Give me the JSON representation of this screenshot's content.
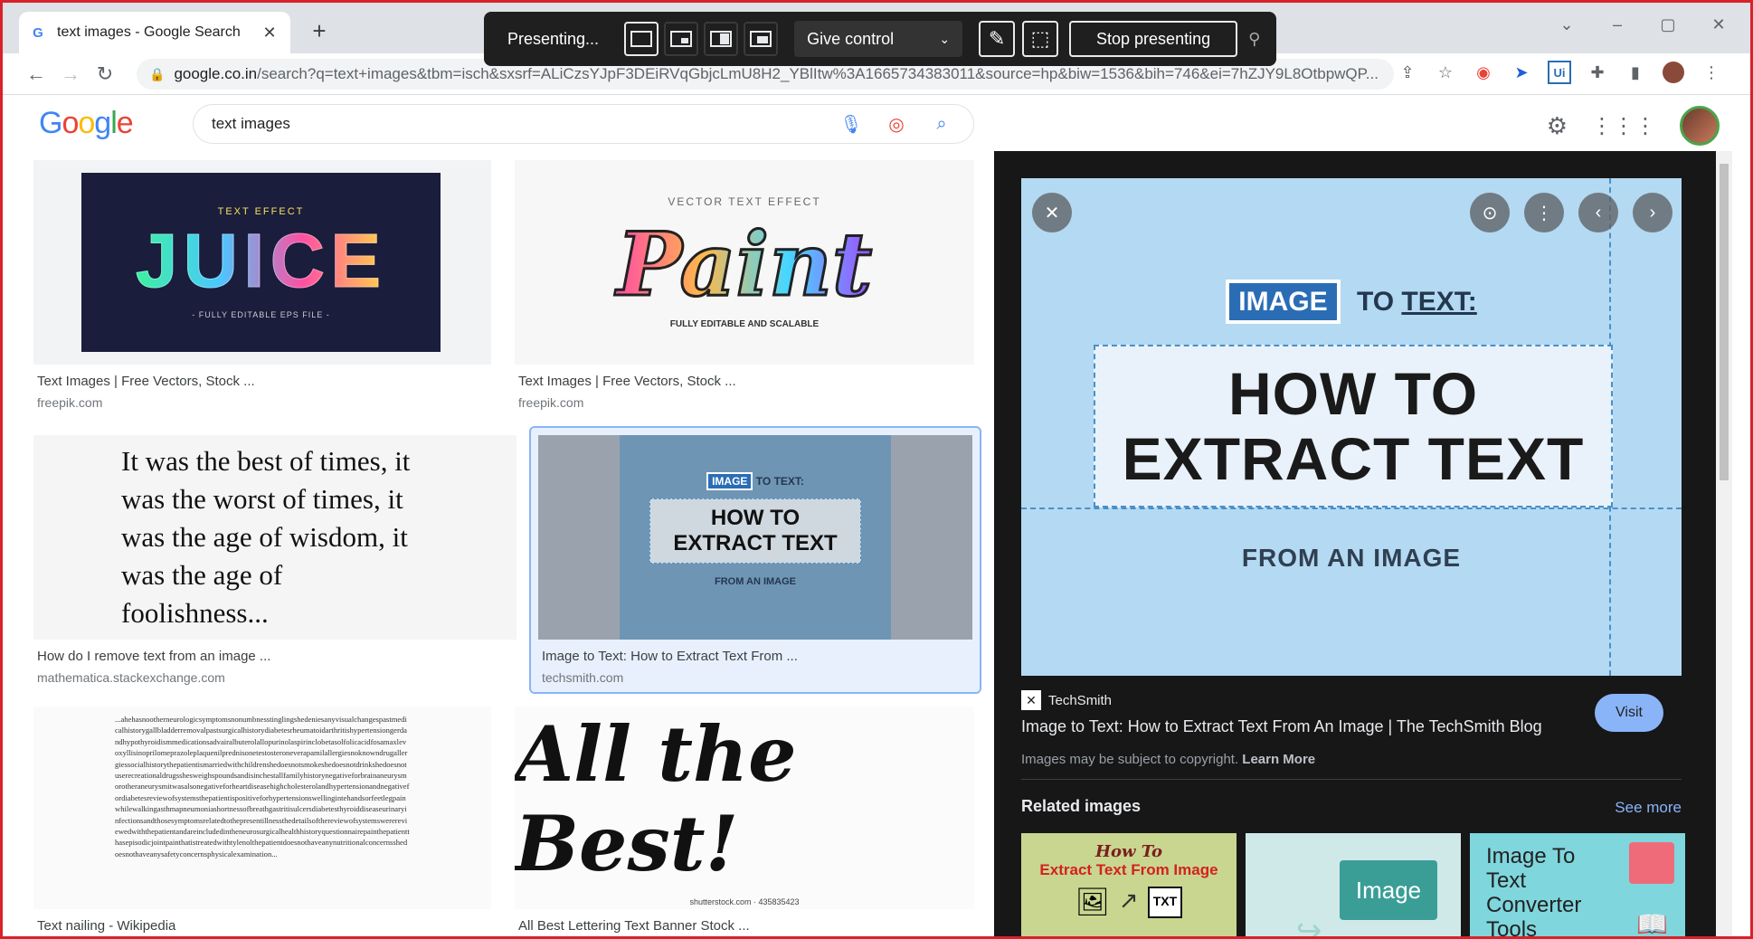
{
  "browser": {
    "tab_title": "text images - Google Search",
    "tab_favicon": "G",
    "tab_close": "✕",
    "new_tab": "+",
    "url_host": "google.co.in",
    "url_path": "/search?q=text+images&tbm=isch&sxsrf=ALiCzsYJpF3DEiRVqGbjcLmU8H2_YBlItw%3A1665734383011&source=hp&biw=1536&bih=746&ei=7hZJY9L8OtbpwQP..."
  },
  "presenting": {
    "label": "Presenting...",
    "give_control": "Give control",
    "stop": "Stop presenting"
  },
  "google": {
    "logo": [
      "G",
      "o",
      "o",
      "g",
      "l",
      "e"
    ],
    "query": "text images"
  },
  "results": [
    {
      "title": "Text Images | Free Vectors, Stock ...",
      "source": "freepik.com",
      "img": {
        "small": "TEXT EFFECT",
        "big": "JUICE",
        "foot": "- FULLY EDITABLE EPS FILE -"
      }
    },
    {
      "title": "Text Images | Free Vectors, Stock ...",
      "source": "freepik.com",
      "img": {
        "small": "VECTOR TEXT EFFECT",
        "big": "Paint",
        "foot": "FULLY EDITABLE AND SCALABLE"
      }
    },
    {
      "title": "How do I remove text from an image ...",
      "source": "mathematica.stackexchange.com",
      "img": {
        "text": "It was the best of times, it was the worst of times, it was the age of wisdom, it was the age of foolishness..."
      }
    },
    {
      "title": "Image to Text: How to Extract Text From ...",
      "source": "techsmith.com",
      "img": {
        "tag": "IMAGE",
        "to": "TO TEXT:",
        "l1": "HOW TO",
        "l2": "EXTRACT TEXT",
        "from": "FROM AN IMAGE"
      }
    },
    {
      "title": "Text nailing - Wikipedia",
      "source": "",
      "img": {
        "text": "...ahehasnootherneurologicsymptomsnonumbnesstinglingshedeniesanyvisualchangespastmedicalhistorygallbladderremovalpastsurgicalhistorydiabetesrheumatoidarthritishypertensiongerdandhypothyroidismmedicationsadvairalbuterolallopurinolaspirinclobetasolfolicacidfosamaxlevoxyllisinoprilomeprazoleplaquenilprednisonetestosteroneverapamilallergiesnoknowndrugallergiessocialhistorythepatientismarriedwithchildrenshedoesnotsmokeshedoesnotdrinkshedoesnotuserecreationaldrugsshesweighspoundsandisinchestallfamilyhistorynegativeforbrainaneurysmorotheraneurysmitwasalsonegativeforheartdiseasehighcholesterolandhypertensionandnegativefordiabetesreviewofsystemsthepatientispositiveforhypertensionswellingintehandsorfeetlegpainwhilewalkingasthmapneumoniashortnessofbreathgastritisulcersdiabetesthyroiddiseaseurinaryinfectionsandthosesymptomsrelatedtothepresentillnessthedetailsofthereviewofsystemswerereviewedwiththepatientandareincludedintheneurosurgicalhealthhistoryquestionnairepainthepatientthasepisodicjointpainthatistreatedwithtylenolthepatientdoesnothaveanynutritionalconcernsshedoesnothaveanysafetyconcernsphysicalexamination..."
      }
    },
    {
      "title": "All Best Lettering Text Banner Stock ...",
      "source": "",
      "img": {
        "big": "All the Best!",
        "foot": "shutterstock.com · 435835423"
      }
    }
  ],
  "panel": {
    "preview": {
      "tag": "IMAGE",
      "to": "TO",
      "text": "TEXT:",
      "l1": "HOW TO",
      "l2": "EXTRACT TEXT",
      "from": "FROM AN IMAGE"
    },
    "source_name": "TechSmith",
    "title": "Image to Text: How to Extract Text From An Image | The TechSmith Blog",
    "visit": "Visit",
    "copyright": "Images may be subject to copyright.",
    "learn_more": "Learn More",
    "related_title": "Related images",
    "see_more": "See more",
    "related": [
      {
        "line1": "How To",
        "line2": "Extract Text From Image",
        "badge": "TXT"
      },
      {
        "label": "Image"
      },
      {
        "line1": "Image To",
        "line2": "Text",
        "line3": "Converter",
        "line4": "Tools"
      }
    ]
  },
  "colors": {
    "accent": "#8ab4f8",
    "frame": "#d8222b",
    "panel_bg": "#171717"
  }
}
